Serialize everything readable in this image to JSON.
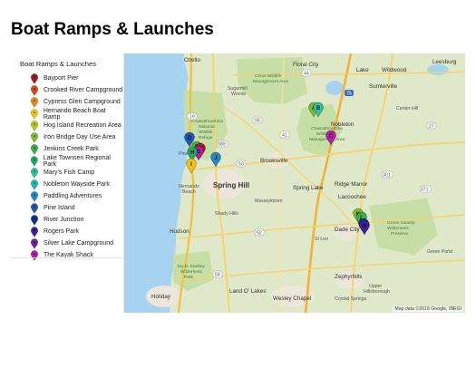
{
  "page_title": "Boat Ramps & Launches",
  "legend": {
    "title": "Boat Ramps & Launches",
    "items": [
      {
        "label": "Bayport Pier",
        "color": "#a01c1c"
      },
      {
        "label": "Crooked River Campground",
        "color": "#d14d12"
      },
      {
        "label": "Cypress Glen Campground",
        "color": "#e58a10"
      },
      {
        "label": "Hernando Beach Boat Ramp",
        "color": "#f2c418"
      },
      {
        "label": "Hog Island Recreation Area",
        "color": "#b8c51b"
      },
      {
        "label": "Iron Bridge Day Use Area",
        "color": "#7cbc2b"
      },
      {
        "label": "Jenkins Creek Park",
        "color": "#38b047"
      },
      {
        "label": "Lake Townsen Regional Park",
        "color": "#21a96b"
      },
      {
        "label": "Mary's Fish Camp",
        "color": "#2fc39b"
      },
      {
        "label": "Nobleton Wayside Park",
        "color": "#23b5c4"
      },
      {
        "label": "Paddling Adventures",
        "color": "#2387c8"
      },
      {
        "label": "Pine Island",
        "color": "#1f56b8"
      },
      {
        "label": "River Junction",
        "color": "#13309a"
      },
      {
        "label": "Rogers Park",
        "color": "#3a1f9e"
      },
      {
        "label": "Silver Lake Campground",
        "color": "#6e1fa4"
      },
      {
        "label": "The Kayak Shack",
        "color": "#b21ea3"
      }
    ]
  },
  "map": {
    "labels": {
      "ozello": "Ozello",
      "citrus_wma": "Citrus Wildlife",
      "citrus_wma2": "Management Area",
      "floral_city": "Floral City",
      "lake_panasoffkee": "Lake",
      "wildwood": "Wildwood",
      "leesburg": "Leesburg",
      "sugarmill_woods": "Sugarmill",
      "sugarmill_woods2": "Woods",
      "sumterville": "Sumterville",
      "center_hill": "Center Hill",
      "chassahowitzka": "Chassahowitzka",
      "chassahowitzka2": "National",
      "chassahowitzka3": "Wildlife",
      "chassahowitzka4": "Refuge",
      "chass_wma": "Chassahowitzka",
      "chass_wma2": "Wildlife",
      "chass_wma3": "Management Area",
      "nobleton": "Nobleton",
      "brooksville": "Brooksville",
      "pine_island": "Pine",
      "spring_hill": "Spring Hill",
      "hernando_beach": "Hernando",
      "hernando_beach2": "Beach",
      "spring_lake": "Spring Lake",
      "ridge_manor": "Ridge Manor",
      "masaryktown": "Masaryktown",
      "lacoochee": "Lacoochee",
      "shady_hills": "Shady Hills",
      "hudson": "Hudson",
      "dade_city": "Dade City",
      "st_leo": "St Leo",
      "green_swamp": "Green Swamp",
      "green_swamp2": "Wilderness",
      "green_swamp3": "Preserve",
      "green_pond": "Green Pond",
      "starkey": "Jay B. Starkey",
      "starkey2": "Wilderness",
      "starkey3": "Park",
      "zephyrhills": "Zephyrhills",
      "upper_hills": "Upper",
      "upper_hills2": "Hillsborough",
      "holiday": "Holiday",
      "land_o_lakes": "Land O' Lakes",
      "wesley_chapel": "Wesley Chapel",
      "crystal_springs": "Crystal Springs",
      "road_19": "19",
      "road_589": "589",
      "road_41": "41",
      "road_98": "98",
      "road_75": "75",
      "road_301": "301",
      "road_50": "50",
      "road_52": "52",
      "road_54": "54",
      "road_471": "471",
      "road_44": "44",
      "road_27": "27"
    },
    "pins": [
      {
        "letter": "A",
        "color": "#7cbc2b"
      },
      {
        "letter": "B",
        "color": "#2fc39b"
      },
      {
        "letter": "C",
        "color": "#b21ea3"
      },
      {
        "letter": "D",
        "color": "#1f56b8"
      },
      {
        "letter": "E",
        "color": "#38b047"
      },
      {
        "letter": "F",
        "color": "#a01c1c"
      },
      {
        "letter": "G",
        "color": "#b21ea3"
      },
      {
        "letter": "H",
        "color": "#21a96b"
      },
      {
        "letter": "I",
        "color": "#f2c418"
      },
      {
        "letter": "J",
        "color": "#2387c8"
      },
      {
        "letter": "K",
        "color": "#7cbc2b"
      },
      {
        "letter": "L",
        "color": "#38b047"
      },
      {
        "letter": "M",
        "color": "#13309a"
      },
      {
        "letter": "N",
        "color": "#3a1f9e"
      }
    ],
    "attribution": "Map data ©2016 Google, INEGI"
  }
}
